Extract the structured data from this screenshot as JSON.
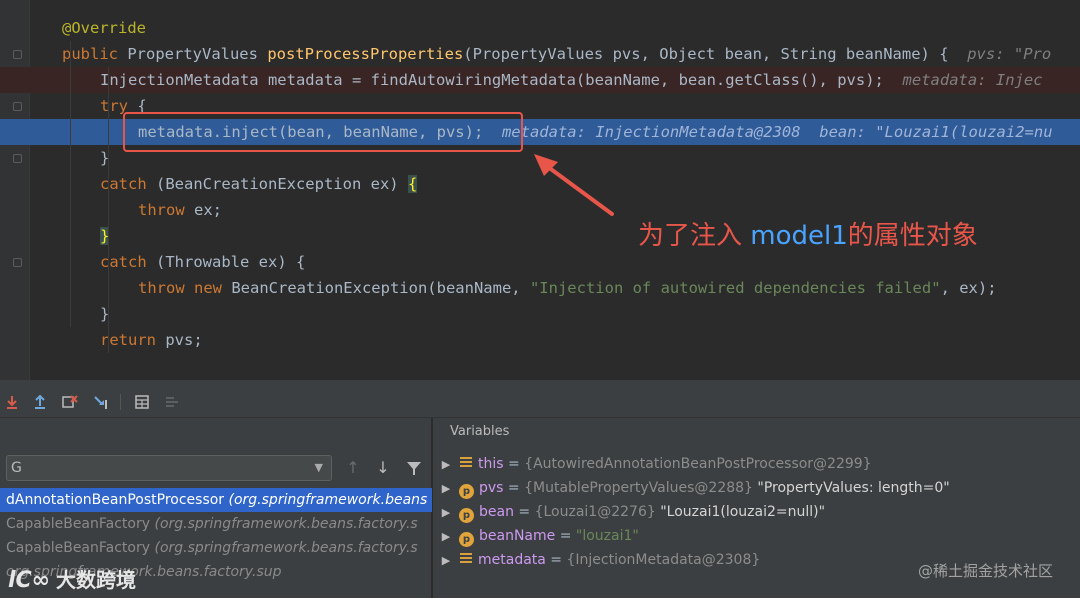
{
  "editor": {
    "lines": [
      {
        "indent": 0,
        "tokens": [
          {
            "t": "@Override",
            "c": "ann"
          }
        ]
      },
      {
        "indent": 0,
        "tokens": [
          {
            "t": "public ",
            "c": "kw"
          },
          {
            "t": "PropertyValues "
          },
          {
            "t": "postProcessProperties",
            "c": "fn"
          },
          {
            "t": "(PropertyValues pvs, Object bean, String beanName) {  "
          },
          {
            "t": "pvs: \"Pro",
            "c": "hint"
          }
        ]
      },
      {
        "indent": 1,
        "hl": "red",
        "tokens": [
          {
            "t": "InjectionMetadata metadata = findAutowiringMetadata(beanName, bean.getClass(), pvs);  "
          },
          {
            "t": "metadata: Injec",
            "c": "hint"
          }
        ]
      },
      {
        "indent": 1,
        "tokens": [
          {
            "t": "try ",
            "c": "kw"
          },
          {
            "t": "{"
          }
        ]
      },
      {
        "indent": 2,
        "hl": "blue",
        "tokens": [
          {
            "t": "metadata.inject(bean, beanName, pvs);  "
          },
          {
            "t": "metadata: InjectionMetadata@2308  bean: \"Louzai1(louzai2=nu",
            "c": "hint-b"
          }
        ]
      },
      {
        "indent": 1,
        "tokens": [
          {
            "t": "}"
          }
        ]
      },
      {
        "indent": 1,
        "tokens": [
          {
            "t": "catch ",
            "c": "kw"
          },
          {
            "t": "(BeanCreationException ex) "
          },
          {
            "t": "{",
            "c": "brace-match"
          }
        ]
      },
      {
        "indent": 2,
        "tokens": [
          {
            "t": "throw ",
            "c": "kw"
          },
          {
            "t": "ex;"
          }
        ]
      },
      {
        "indent": 1,
        "tokens": [
          {
            "t": "}",
            "c": "brace-match"
          }
        ]
      },
      {
        "indent": 1,
        "tokens": [
          {
            "t": "catch ",
            "c": "kw"
          },
          {
            "t": "(Throwable ex) {"
          }
        ]
      },
      {
        "indent": 2,
        "tokens": [
          {
            "t": "throw new ",
            "c": "kw"
          },
          {
            "t": "BeanCreationException(beanName, "
          },
          {
            "t": "\"Injection of autowired dependencies failed\"",
            "c": "str"
          },
          {
            "t": ", ex);"
          }
        ]
      },
      {
        "indent": 1,
        "tokens": [
          {
            "t": "}"
          }
        ]
      },
      {
        "indent": 1,
        "tokens": [
          {
            "t": "return ",
            "c": "kw"
          },
          {
            "t": "pvs;"
          }
        ]
      }
    ]
  },
  "callout": {
    "before": "为了注入 ",
    "highlight": "model1",
    "after": "的属性对象",
    "color": "#e8564a"
  },
  "toolbar": {
    "icons": [
      "step-into-icon",
      "step-out-icon",
      "drop-frame-icon",
      "run-to-cursor-icon",
      "evaluate-expression-icon",
      "trace-icon"
    ]
  },
  "frames": {
    "thread_value": "G",
    "rows": [
      {
        "method": "dAnnotationBeanPostProcessor ",
        "pkg": "(org.springframework.beans",
        "selected": true
      },
      {
        "method": "CapableBeanFactory ",
        "pkg": "(org.springframework.beans.factory.s",
        "selected": false
      },
      {
        "method": "CapableBeanFactory ",
        "pkg": "(org.springframework.beans.factory.s",
        "selected": false
      },
      {
        "method": "",
        "pkg": "org.springframework.beans.factory.sup",
        "selected": false
      }
    ]
  },
  "variables": {
    "title": "Variables",
    "rows": [
      {
        "icon": "list",
        "name": "this",
        "obj": "{AutowiredAnnotationBeanPostProcessor@2299}",
        "val": "",
        "val_type": ""
      },
      {
        "icon": "p",
        "name": "pvs",
        "obj": "{MutablePropertyValues@2288}",
        "val": "\"PropertyValues: length=0\"",
        "val_type": "text"
      },
      {
        "icon": "p",
        "name": "bean",
        "obj": "{Louzai1@2276}",
        "val": "\"Louzai1(louzai2=null)\"",
        "val_type": "text"
      },
      {
        "icon": "p",
        "name": "beanName",
        "obj": "",
        "val": "\"louzai1\"",
        "val_type": "str"
      },
      {
        "icon": "list",
        "name": "metadata",
        "obj": "{InjectionMetadata@2308}",
        "val": "",
        "val_type": ""
      }
    ]
  },
  "watermarks": {
    "right": "@稀土掘金技术社区",
    "left_logo": "lC∞",
    "left_text": "大数跨境"
  }
}
